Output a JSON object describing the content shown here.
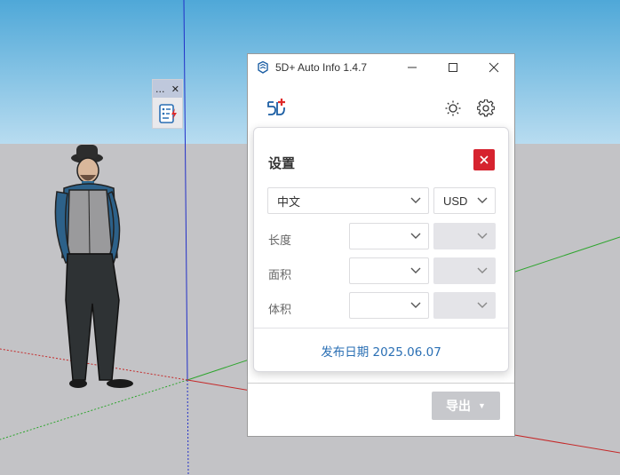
{
  "window": {
    "title": "5D+ Auto Info 1.4.7",
    "controls": {
      "minimize": "─",
      "maximize": "☐",
      "close": "✕"
    }
  },
  "mini_toolbar": {
    "grip_label": "...",
    "close_label": "✕"
  },
  "header": {
    "brand_icon": "5d-plus-logo",
    "theme_icon": "sun-icon",
    "settings_icon": "gear-icon"
  },
  "settings": {
    "title": "设置",
    "close_label": "✕",
    "language": {
      "value": "中文"
    },
    "currency": {
      "value": "USD"
    },
    "rows": [
      {
        "label": "长度",
        "unit": "",
        "precision": ""
      },
      {
        "label": "面积",
        "unit": "",
        "precision": ""
      },
      {
        "label": "体积",
        "unit": "",
        "precision": ""
      }
    ],
    "release": "发布日期 2025.06.07"
  },
  "footer": {
    "export_label": "导出",
    "export_caret": "▼"
  },
  "colors": {
    "accent_red": "#d6232f",
    "link_blue": "#2a6fb4",
    "sky_top": "#4fa8d8",
    "ground": "#c3c3c6"
  }
}
